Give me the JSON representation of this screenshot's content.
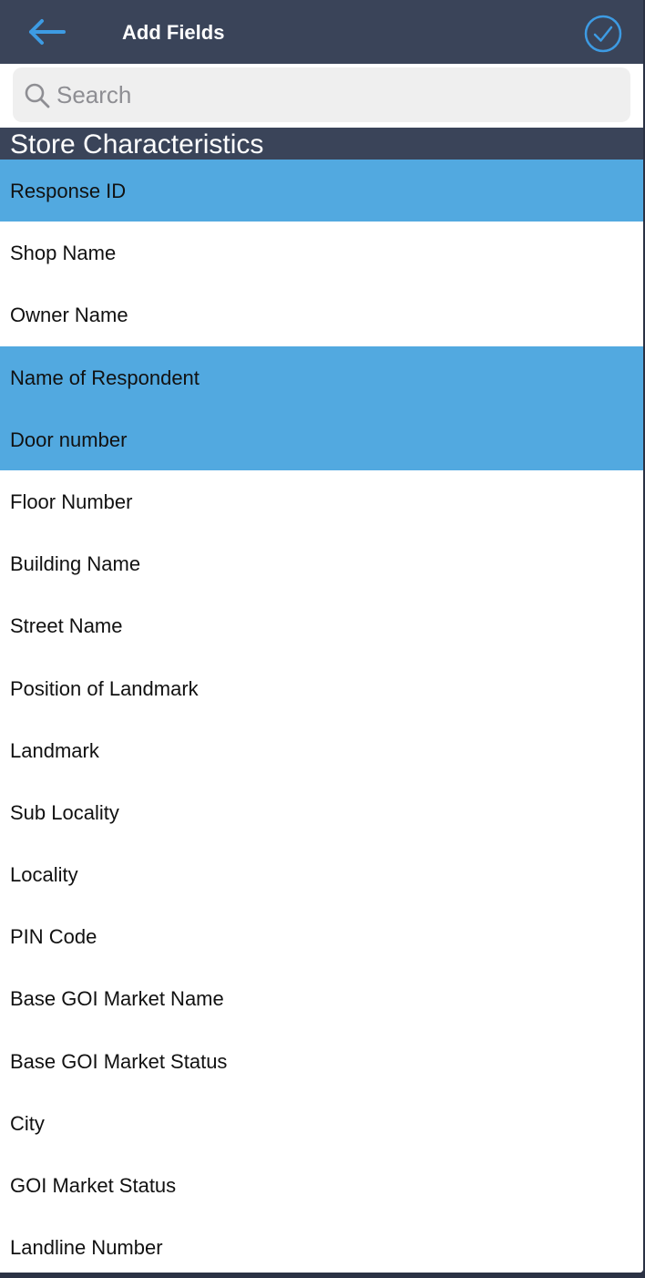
{
  "nav": {
    "title": "Add Fields",
    "back_icon": "arrow-left-icon",
    "done_icon": "check-circle-icon"
  },
  "search": {
    "placeholder": "Search",
    "value": ""
  },
  "section": {
    "title": "Store Characteristics"
  },
  "colors": {
    "nav_bg": "#3a4459",
    "accent": "#3d9be3",
    "selected_row": "#52a9e0"
  },
  "fields": [
    {
      "label": "Response ID",
      "selected": true
    },
    {
      "label": "Shop Name",
      "selected": false
    },
    {
      "label": "Owner Name",
      "selected": false
    },
    {
      "label": "Name of Respondent",
      "selected": true
    },
    {
      "label": "Door number",
      "selected": true
    },
    {
      "label": "Floor Number",
      "selected": false
    },
    {
      "label": "Building Name",
      "selected": false
    },
    {
      "label": "Street Name",
      "selected": false
    },
    {
      "label": "Position of Landmark",
      "selected": false
    },
    {
      "label": "Landmark",
      "selected": false
    },
    {
      "label": "Sub Locality",
      "selected": false
    },
    {
      "label": "Locality",
      "selected": false
    },
    {
      "label": "PIN Code",
      "selected": false
    },
    {
      "label": "Base GOI Market Name",
      "selected": false
    },
    {
      "label": "Base GOI Market Status",
      "selected": false
    },
    {
      "label": "City",
      "selected": false
    },
    {
      "label": "GOI Market Status",
      "selected": false
    },
    {
      "label": "Landline Number",
      "selected": false
    }
  ]
}
